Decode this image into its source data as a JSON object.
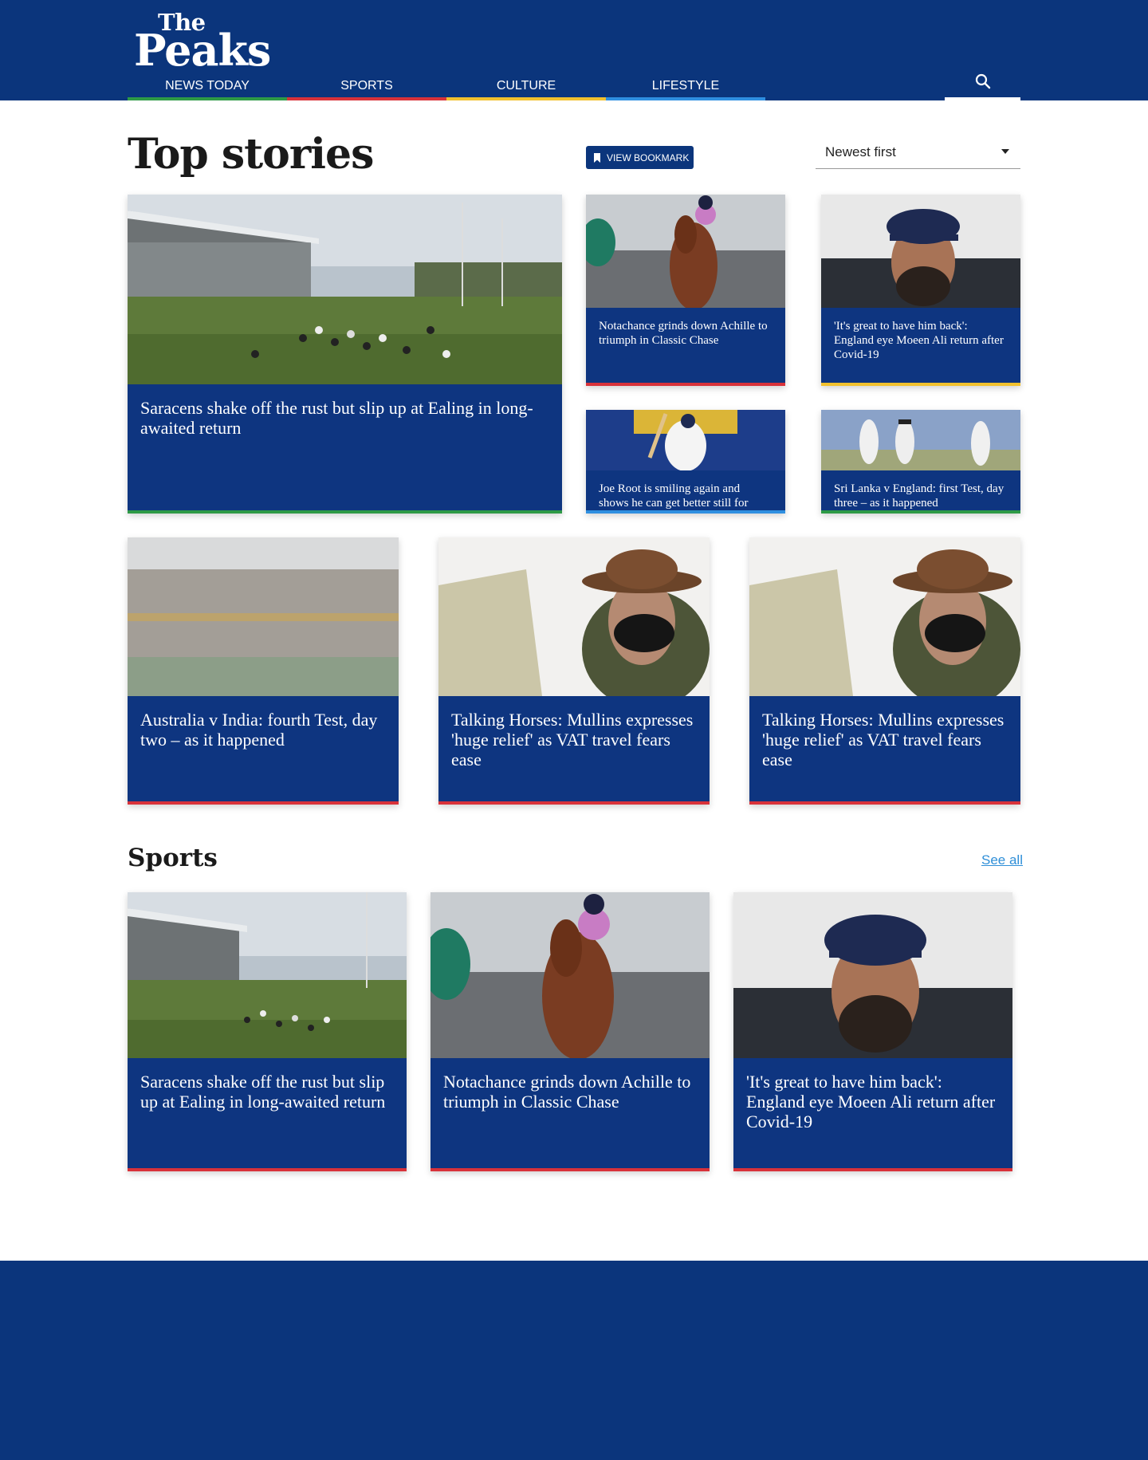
{
  "brand": {
    "logo_line1": "The",
    "logo_line2": "Peaks"
  },
  "nav": [
    {
      "label": "NEWS TODAY",
      "accent": "#2e9a46"
    },
    {
      "label": "SPORTS",
      "accent": "#d8323a"
    },
    {
      "label": "CULTURE",
      "accent": "#f2c12e"
    },
    {
      "label": "LIFESTYLE",
      "accent": "#2f8fe0"
    }
  ],
  "search": {
    "icon": "search-icon"
  },
  "top_stories": {
    "title": "Top stories",
    "bookmark_label": "VIEW BOOKMARK",
    "bookmark_icon": "bookmark-icon",
    "sort_value": "Newest first",
    "cards": [
      {
        "headline": "Saracens shake off the rust but slip up at Ealing in long-awaited return",
        "accent": "#2e9a46"
      },
      {
        "headline": "Notachance grinds down Achille to triumph in Classic Chase",
        "accent": "#d8323a"
      },
      {
        "headline": "'It's great to have him back': England eye Moeen Ali return after Covid-19",
        "accent": "#f2c12e"
      },
      {
        "headline": "Joe Root is smiling again and shows he can get better still for England | Andy Bull",
        "accent": "#2f8fe0"
      },
      {
        "headline": "Sri Lanka v England: first Test, day three – as it happened",
        "accent": "#2e9a46"
      },
      {
        "headline": "Australia v India: fourth Test, day two – as it happened",
        "accent": "#d8323a"
      },
      {
        "headline": "Talking Horses: Mullins expresses 'huge relief' as VAT travel fears ease",
        "accent": "#d8323a"
      },
      {
        "headline": "Talking Horses: Mullins expresses 'huge relief' as VAT travel fears ease",
        "accent": "#d8323a"
      }
    ]
  },
  "sports": {
    "title": "Sports",
    "see_all": "See all",
    "cards": [
      {
        "headline": "Saracens shake off the rust but slip up at Ealing in long-awaited return",
        "accent": "#d8323a"
      },
      {
        "headline": "Notachance grinds down Achille to triumph in Classic Chase",
        "accent": "#d8323a"
      },
      {
        "headline": "'It's great to have him back': England eye Moeen Ali return after Covid-19",
        "accent": "#d8323a"
      }
    ]
  },
  "colors": {
    "brand_blue": "#0b357c",
    "caption_blue": "#0e3580",
    "link": "#2f8fd8"
  }
}
